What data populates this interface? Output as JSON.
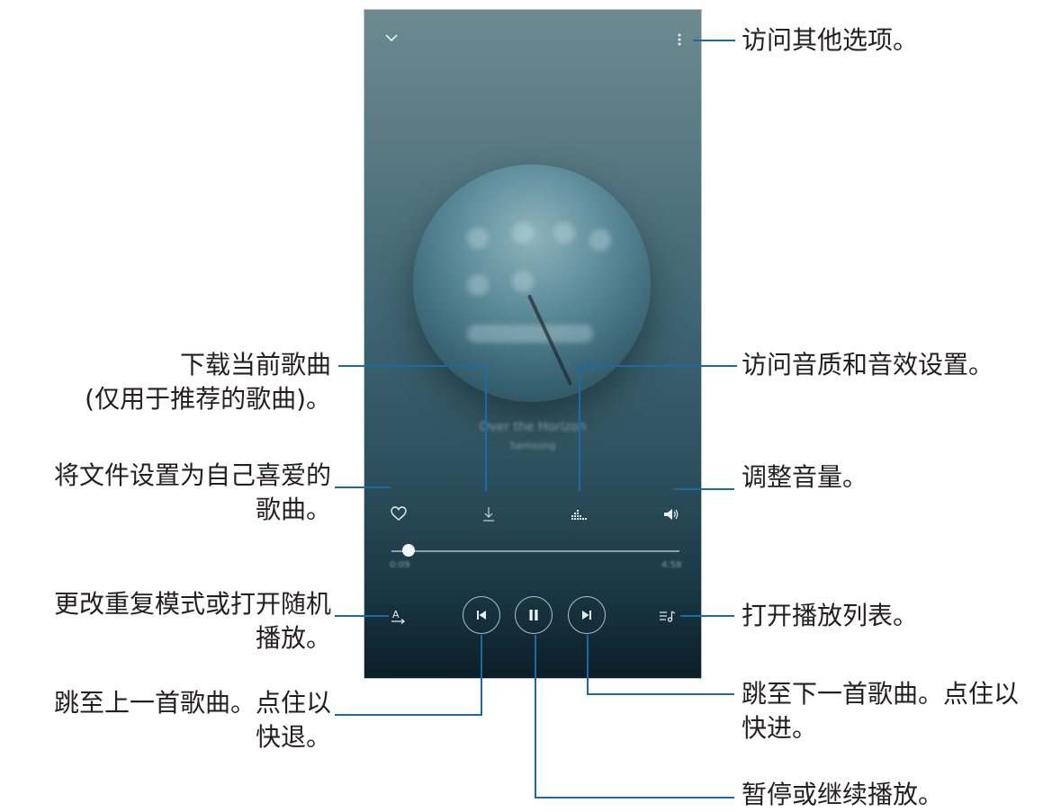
{
  "player": {
    "song_title": "Over the Horizon",
    "artist": "Samsung",
    "elapsed": "0:09",
    "duration": "4:58",
    "progress": 0.03
  },
  "icons": {
    "collapse": "chevron-down-icon",
    "more": "more-vertical-icon",
    "favorite": "heart-icon",
    "download": "download-icon",
    "sound_quality": "equalizer-icon",
    "volume": "volume-icon",
    "repeat": "repeat-mode-icon",
    "previous": "skip-previous-icon",
    "play_pause": "pause-icon",
    "next": "skip-next-icon",
    "playlist": "playlist-icon"
  },
  "callouts": {
    "more_options": "访问其他选项。",
    "download_line1": "下载当前歌曲",
    "download_line2": "(仅用于推荐的歌曲)。",
    "sound_quality": "访问音质和音效设置。",
    "favorite_line1": "将文件设置为自己喜爱的",
    "favorite_line2": "歌曲。",
    "volume": "调整音量。",
    "repeat_line1": "更改重复模式或打开随机",
    "repeat_line2": "播放。",
    "playlist": "打开播放列表。",
    "previous_line1": "跳至上一首歌曲。点住以",
    "previous_line2": "快退。",
    "next_line1": "跳至下一首歌曲。点住以",
    "next_line2": "快进。",
    "pause": "暂停或继续播放。"
  },
  "colors": {
    "callout_line": "#1a6aa5",
    "label_text": "#231f20"
  }
}
